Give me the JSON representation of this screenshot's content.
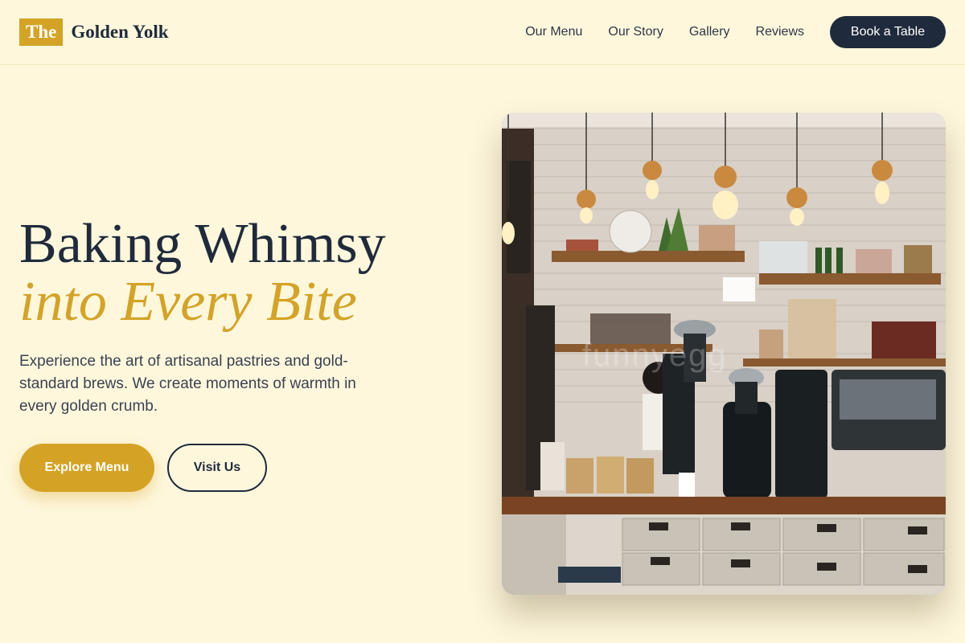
{
  "brand": {
    "mark": "The",
    "name": "Golden Yolk"
  },
  "nav": {
    "links": [
      "Our Menu",
      "Our Story",
      "Gallery",
      "Reviews"
    ],
    "cta": "Book a Table"
  },
  "hero": {
    "title_line1": "Baking Whimsy",
    "title_line2": "into Every Bite",
    "description": "Experience the art of artisanal pastries and gold-standard brews. We create moments of warmth in every golden crumb.",
    "primary_button": "Explore Menu",
    "secondary_button": "Visit Us",
    "image_watermark": "funnyegg"
  },
  "colors": {
    "background": "#fef7dc",
    "accent": "#d4a326",
    "navy": "#1f2a3c"
  }
}
